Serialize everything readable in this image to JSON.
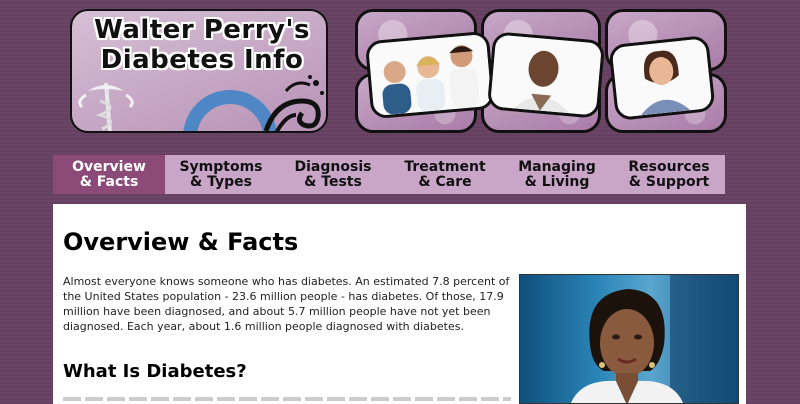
{
  "site": {
    "logo_line1": "Walter Perry's",
    "logo_line2": "Diabetes Info"
  },
  "nav": {
    "items": [
      {
        "line1": "Overview",
        "line2": "& Facts",
        "active": true
      },
      {
        "line1": "Symptoms",
        "line2": "& Types"
      },
      {
        "line1": "Diagnosis",
        "line2": "& Tests"
      },
      {
        "line1": "Treatment",
        "line2": "& Care"
      },
      {
        "line1": "Managing",
        "line2": "& Living"
      },
      {
        "line1": "Resources",
        "line2": "& Support"
      }
    ]
  },
  "main": {
    "title": "Overview & Facts",
    "intro": "Almost everyone knows someone who has diabetes. An estimated 7.8 percent of the United States population - 23.6 million people - has diabetes. Of those, 17.9 million have been diagnosed, and about 5.7 million people have not yet been diagnosed. Each year, about 1.6 million people diagnosed with diabetes.",
    "section_heading": "What Is Diabetes?"
  },
  "colors": {
    "page_bg": "#6b4565",
    "nav_bg": "#c9a6c7",
    "nav_active_bg": "#8c4a78",
    "logo_bg": "#c7a9c6"
  },
  "icons": {
    "logo_emblem": "caduceus-icon",
    "logo_ring": "blue-circle-icon",
    "logo_swirl": "swirl-icon"
  }
}
